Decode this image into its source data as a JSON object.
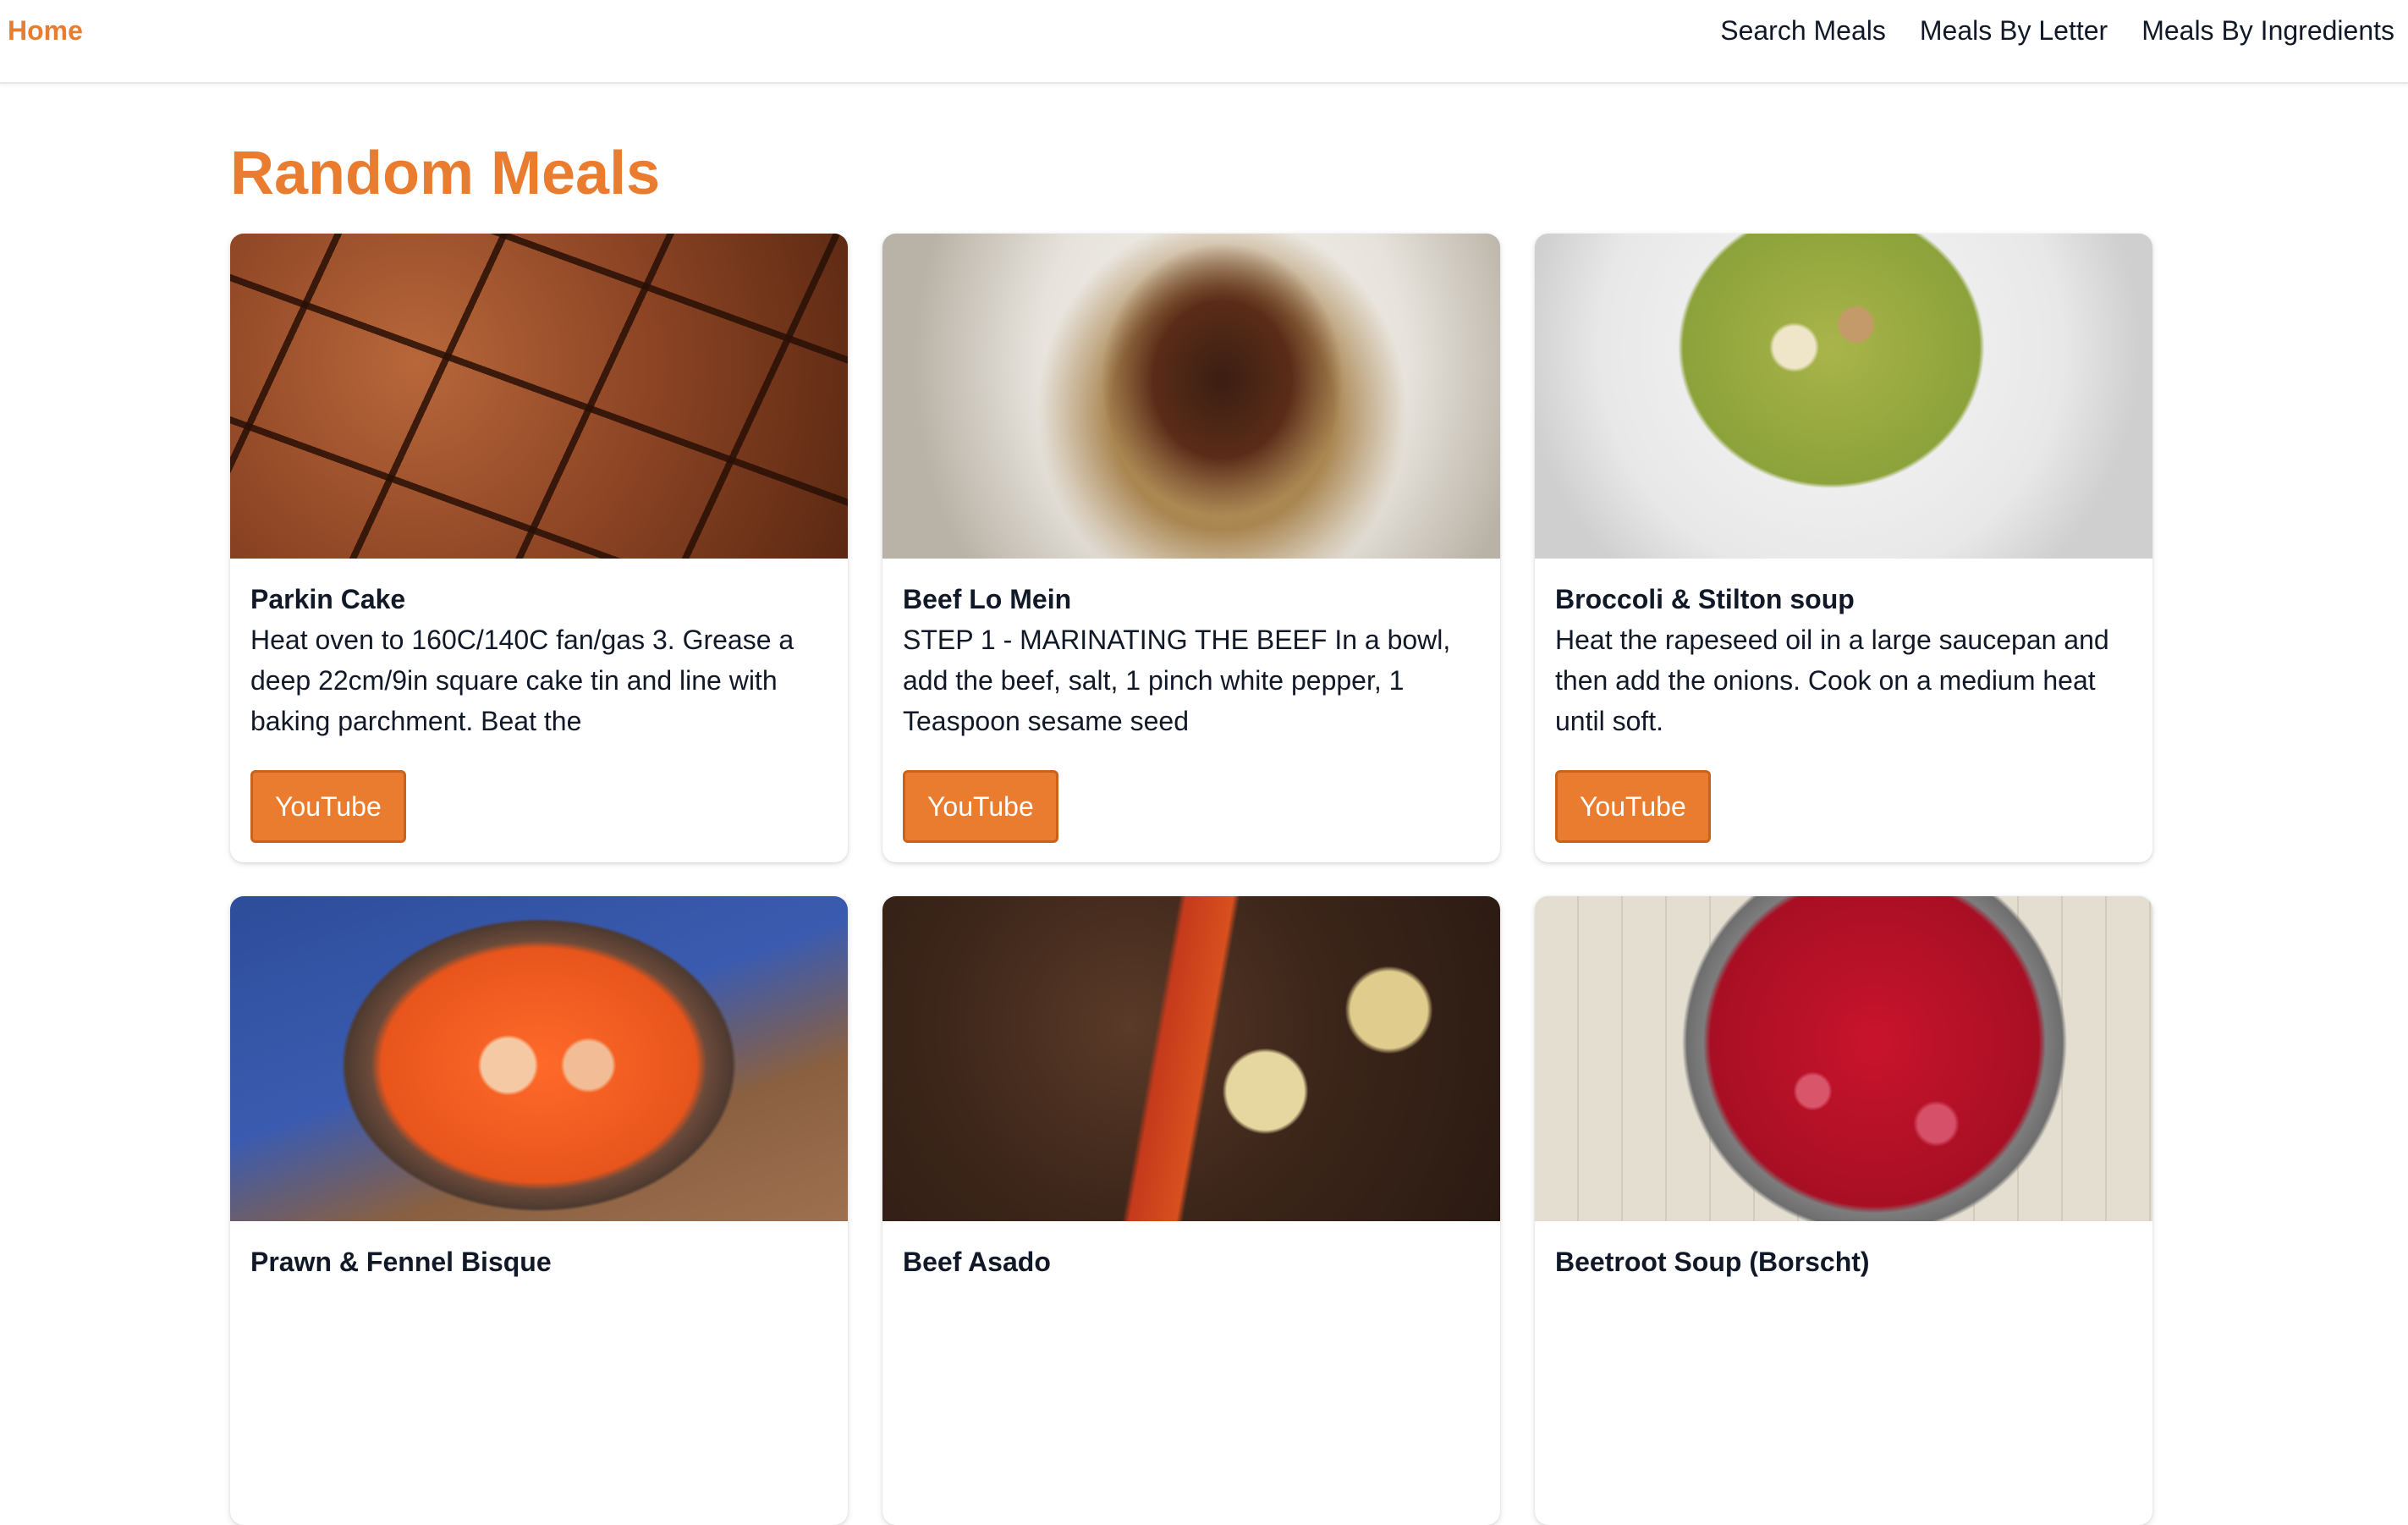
{
  "nav": {
    "home": "Home",
    "links": [
      "Search Meals",
      "Meals By Letter",
      "Meals By Ingredients"
    ]
  },
  "page": {
    "title": "Random Meals"
  },
  "meals": [
    {
      "title": "Parkin Cake",
      "description": "Heat oven to 160C/140C fan/gas 3. Grease a deep 22cm/9in square cake tin and line with baking parchment. Beat the",
      "button": "YouTube"
    },
    {
      "title": "Beef Lo Mein",
      "description": "STEP 1 - MARINATING THE BEEF In a bowl, add the beef, salt, 1 pinch white pepper, 1 Teaspoon sesame seed",
      "button": "YouTube"
    },
    {
      "title": "Broccoli & Stilton soup",
      "description": "Heat the rapeseed oil in a large saucepan and then add the onions. Cook on a medium heat until soft.",
      "button": "YouTube"
    },
    {
      "title": "Prawn & Fennel Bisque",
      "description": "",
      "button": ""
    },
    {
      "title": "Beef Asado",
      "description": "",
      "button": ""
    },
    {
      "title": "Beetroot Soup (Borscht)",
      "description": "",
      "button": ""
    }
  ],
  "colors": {
    "accent": "#ea7c30",
    "text": "#111827"
  }
}
